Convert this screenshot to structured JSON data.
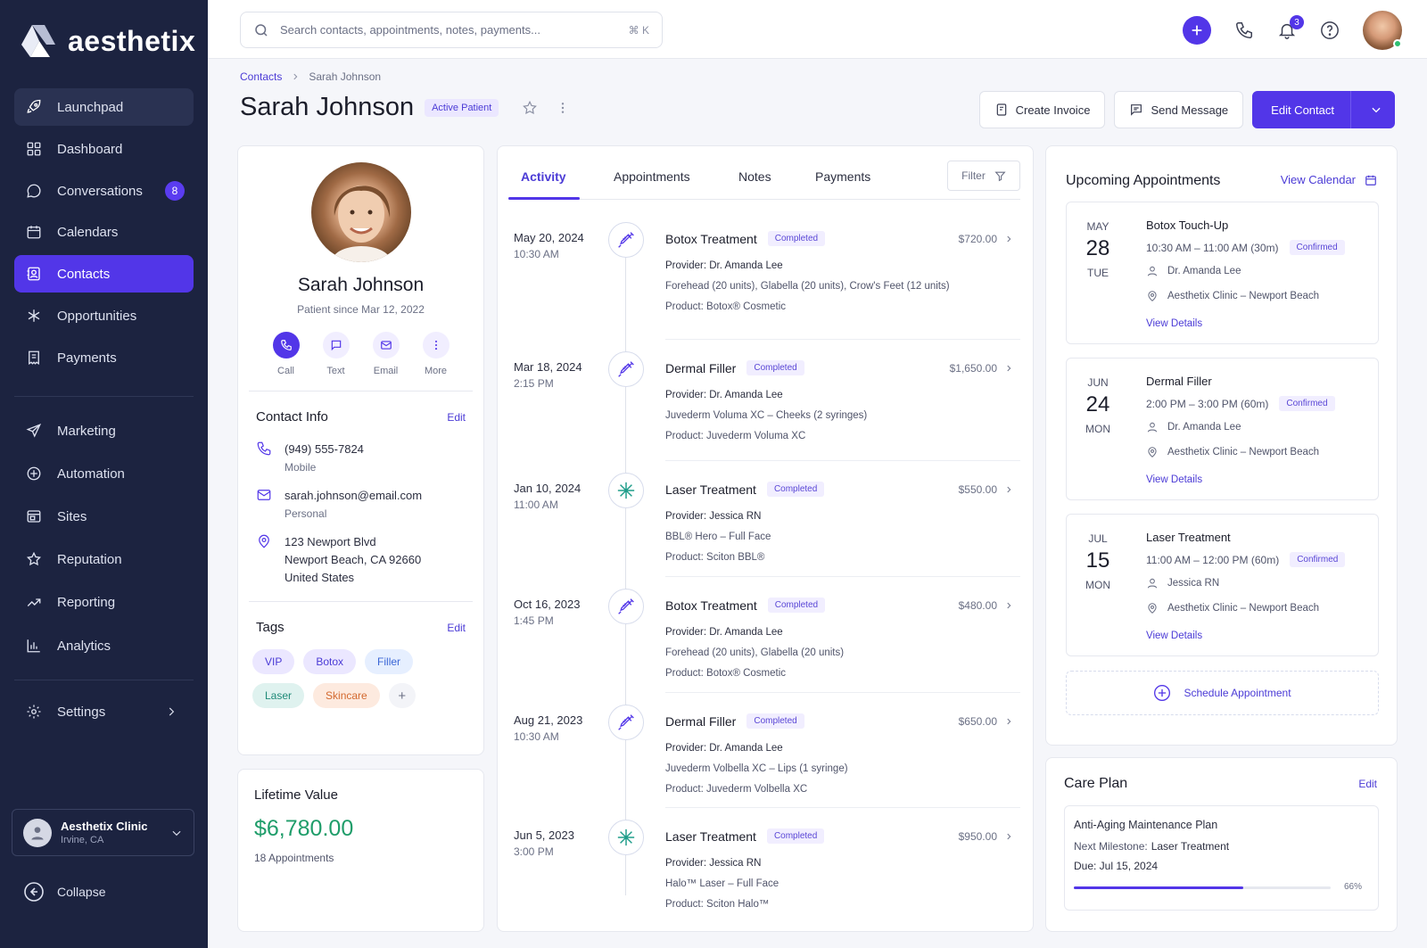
{
  "sidebar": {
    "brand": "aesthetix",
    "items": [
      {
        "label": "Launchpad"
      },
      {
        "label": "Dashboard"
      },
      {
        "label": "Conversations",
        "badge": "8"
      },
      {
        "label": "Calendars"
      },
      {
        "label": "Contacts"
      },
      {
        "label": "Opportunities"
      },
      {
        "label": "Payments"
      },
      {
        "label": "Marketing"
      },
      {
        "label": "Automation"
      },
      {
        "label": "Sites"
      },
      {
        "label": "Reputation"
      },
      {
        "label": "Reporting"
      },
      {
        "label": "Analytics"
      },
      {
        "label": "Settings"
      }
    ],
    "clinic": {
      "name": "Aesthetix Clinic",
      "location": "Irvine, CA"
    },
    "collapse": "Collapse"
  },
  "topbar": {
    "search_placeholder": "Search contacts, appointments, notes, payments...",
    "shortcut": "⌘ K",
    "notifications": "3"
  },
  "header": {
    "breadcrumb": [
      "Contacts",
      "Sarah Johnson"
    ],
    "name": "Sarah Johnson",
    "status": "Active Patient",
    "actions": {
      "create_invoice": "Create Invoice",
      "send_message": "Send Message",
      "edit_contact": "Edit Contact"
    }
  },
  "profile": {
    "name": "Sarah Johnson",
    "since": "Patient since Mar 12, 2022",
    "quick_actions": [
      "Call",
      "Text",
      "Email",
      "More"
    ],
    "contact_info": {
      "title": "Contact Info",
      "edit": "Edit",
      "phone": "(949) 555-7824",
      "phone_type": "Mobile",
      "email": "sarah.johnson@email.com",
      "email_type": "Personal",
      "address_1": "123 Newport Blvd",
      "address_2": "Newport Beach, CA 92660",
      "address_3": "United States"
    },
    "tags": {
      "title": "Tags",
      "edit": "Edit",
      "items": [
        {
          "label": "VIP",
          "bg": "#ebe7ff",
          "fg": "#4b3bd6"
        },
        {
          "label": "Botox",
          "bg": "#ebe7ff",
          "fg": "#4b3bd6"
        },
        {
          "label": "Filler",
          "bg": "#e6efff",
          "fg": "#3a66d6"
        },
        {
          "label": "Laser",
          "bg": "#dff2ef",
          "fg": "#1f8a78"
        },
        {
          "label": "Skincare",
          "bg": "#fdeadf",
          "fg": "#d3692f"
        }
      ],
      "add": "+"
    }
  },
  "lifetime": {
    "title": "Lifetime Value",
    "value": "$6,780.00",
    "appointments": "18 Appointments"
  },
  "activity": {
    "tabs": [
      "Activity",
      "Appointments",
      "Notes",
      "Payments"
    ],
    "filter": "Filter",
    "items": [
      {
        "date": "May 20, 2024",
        "time": "10:30 AM",
        "title": "Botox Treatment",
        "status": "Completed",
        "amount": "$720.00",
        "provider_label": "Provider:",
        "provider": "Dr. Amanda Lee",
        "detail": "Forehead (20 units), Glabella (20 units), Crow's Feet (12 units)",
        "product_label": "Product:",
        "product": "Botox® Cosmetic",
        "icon": "syringe-icon"
      },
      {
        "date": "Mar 18, 2024",
        "time": "2:15 PM",
        "title": "Dermal Filler",
        "status": "Completed",
        "amount": "$1,650.00",
        "provider_label": "Provider:",
        "provider": "Dr. Amanda Lee",
        "detail": "Juvederm Voluma XC – Cheeks (2 syringes)",
        "product_label": "Product:",
        "product": "Juvederm Voluma XC",
        "icon": "syringe-icon"
      },
      {
        "date": "Jan 10, 2024",
        "time": "11:00 AM",
        "title": "Laser Treatment",
        "status": "Completed",
        "amount": "$550.00",
        "provider_label": "Provider:",
        "provider": "Jessica RN",
        "detail": "BBL® Hero – Full Face",
        "product_label": "Product:",
        "product": "Sciton BBL®",
        "icon": "laser-icon"
      },
      {
        "date": "Oct 16, 2023",
        "time": "1:45 PM",
        "title": "Botox Treatment",
        "status": "Completed",
        "amount": "$480.00",
        "provider_label": "Provider:",
        "provider": "Dr. Amanda Lee",
        "detail": "Forehead (20 units), Glabella (20 units)",
        "product_label": "Product:",
        "product": "Botox® Cosmetic",
        "icon": "syringe-icon"
      },
      {
        "date": "Aug 21, 2023",
        "time": "10:30 AM",
        "title": "Dermal Filler",
        "status": "Completed",
        "amount": "$650.00",
        "provider_label": "Provider:",
        "provider": "Dr. Amanda Lee",
        "detail": "Juvederm Volbella XC – Lips (1 syringe)",
        "product_label": "Product:",
        "product": "Juvederm Volbella XC",
        "icon": "syringe-icon"
      },
      {
        "date": "Jun 5, 2023",
        "time": "3:00 PM",
        "title": "Laser Treatment",
        "status": "Completed",
        "amount": "$950.00",
        "provider_label": "Provider:",
        "provider": "Jessica RN",
        "detail": "Halo™ Laser – Full Face",
        "product_label": "Product:",
        "product": "Sciton Halo™",
        "icon": "laser-icon"
      }
    ]
  },
  "upcoming": {
    "title": "Upcoming Appointments",
    "view_calendar": "View Calendar",
    "items": [
      {
        "month": "MAY",
        "day": "28",
        "dow": "TUE",
        "title": "Botox Touch-Up",
        "time": "10:30 AM – 11:00 AM (30m)",
        "status": "Confirmed",
        "provider": "Dr. Amanda Lee",
        "location": "Aesthetix Clinic – Newport Beach",
        "link": "View Details"
      },
      {
        "month": "JUN",
        "day": "24",
        "dow": "MON",
        "title": "Dermal Filler",
        "time": "2:00 PM – 3:00 PM (60m)",
        "status": "Confirmed",
        "provider": "Dr. Amanda Lee",
        "location": "Aesthetix Clinic – Newport Beach",
        "link": "View Details"
      },
      {
        "month": "JUL",
        "day": "15",
        "dow": "MON",
        "title": "Laser Treatment",
        "time": "11:00 AM – 12:00 PM (60m)",
        "status": "Confirmed",
        "provider": "Jessica RN",
        "location": "Aesthetix Clinic – Newport Beach",
        "link": "View Details"
      }
    ],
    "schedule": "Schedule Appointment"
  },
  "care_plan": {
    "title": "Care Plan",
    "edit": "Edit",
    "plan": "Anti-Aging Maintenance Plan",
    "milestone_label": "Next Milestone:",
    "milestone": "Laser Treatment",
    "due": "Due: Jul 15, 2024",
    "progress_label": "66%",
    "progress_value": 0.66
  },
  "colors": {
    "accent": "#5236e8",
    "sidebar_bg": "#1c2340",
    "success": "#1f9d6a"
  }
}
